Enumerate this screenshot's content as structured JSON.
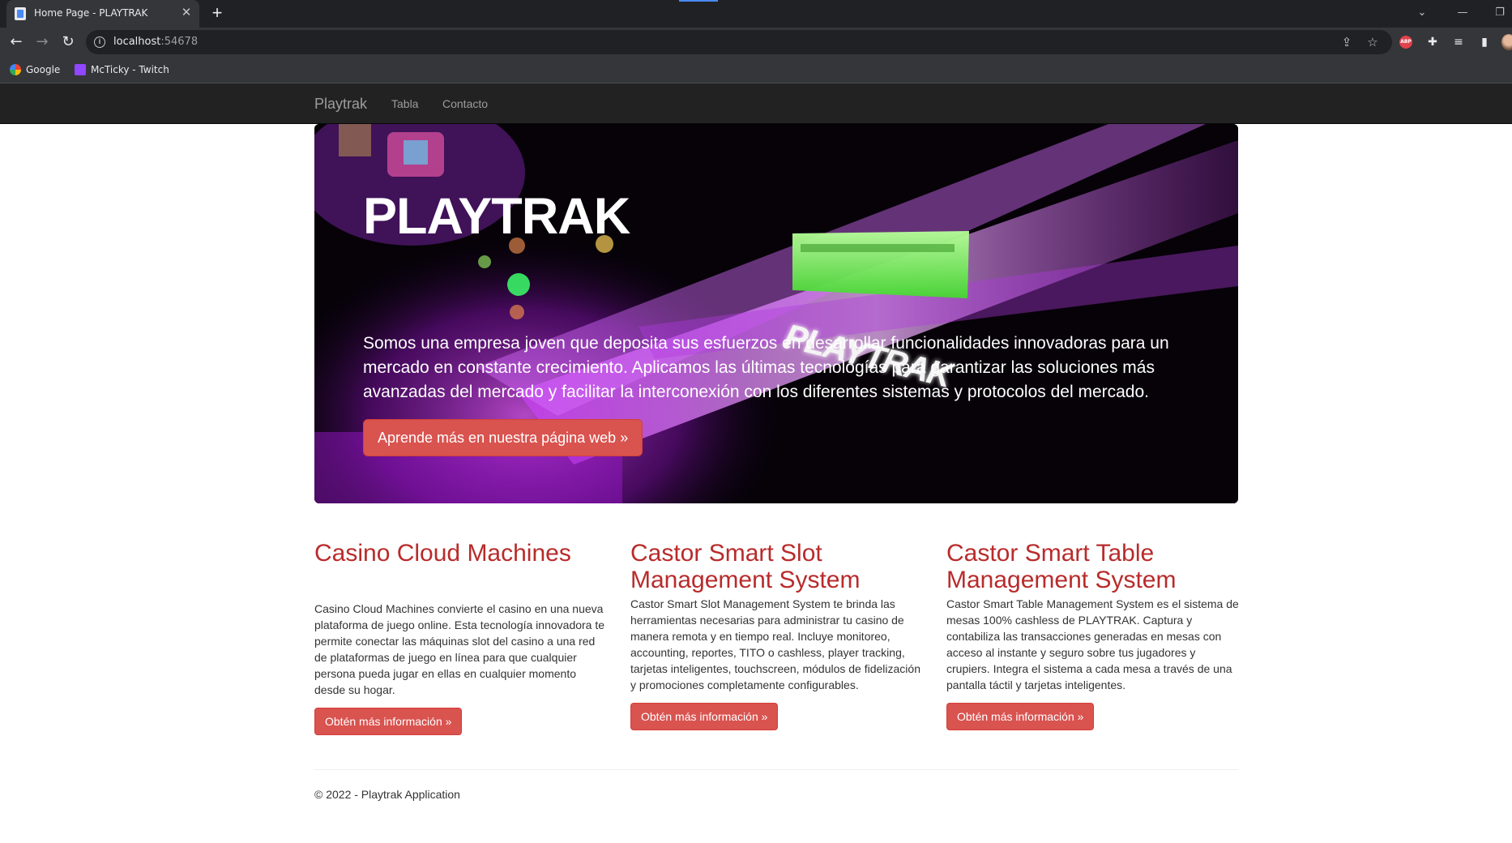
{
  "browser": {
    "tab_title": "Home Page - PLAYTRAK",
    "tab_close": "✕",
    "new_tab": "+",
    "url_host": "localhost",
    "url_port": ":54678",
    "bookmarks": [
      {
        "label": "Google",
        "icon": "google-icon"
      },
      {
        "label": "McTicky - Twitch",
        "icon": "twitch-icon"
      }
    ],
    "abp_label": "ABP"
  },
  "navbar": {
    "brand": "Playtrak",
    "links": [
      "Tabla",
      "Contacto"
    ]
  },
  "hero": {
    "title": "PLAYTRAK",
    "lead": "Somos una empresa joven que deposita sus esfuerzos en desarrollar funcionalidades innovadoras para un mercado en constante crecimiento. Aplicamos las últimas tecnologías para garantizar las soluciones más avanzadas del mercado y facilitar la interconexión con los diferentes sistemas y protocolos del mercado.",
    "button": "Aprende más en nuestra página web »",
    "image_text": "PLAYTRAK"
  },
  "columns": [
    {
      "title": "Casino Cloud Machines",
      "text": "Casino Cloud Machines convierte el casino en una nueva plataforma de juego online. Esta tecnología innovadora te permite conectar las máquinas slot del casino a una red de plataformas de juego en línea para que cualquier persona pueda jugar en ellas en cualquier momento desde su hogar.",
      "button": "Obtén más información »"
    },
    {
      "title": "Castor Smart Slot Management System",
      "text": "Castor Smart Slot Management System te brinda las herramientas necesarias para administrar tu casino de manera remota y en tiempo real. Incluye monitoreo, accounting, reportes, TITO o cashless, player tracking, tarjetas inteligentes, touchscreen, módulos de fidelización y promociones completamente configurables.",
      "button": "Obtén más información »"
    },
    {
      "title": "Castor Smart Table Management System",
      "text": "Castor Smart Table Management System es el sistema de mesas 100% cashless de PLAYTRAK. Captura y contabiliza las transacciones generadas en mesas con acceso al instante y seguro sobre tus jugadores y crupiers. Integra el sistema a cada mesa a través de una pantalla táctil y tarjetas inteligentes.",
      "button": "Obtén más información »"
    }
  ],
  "footer": {
    "text": "© 2022 - Playtrak Application"
  },
  "colors": {
    "navbar_bg": "#222222",
    "accent_red": "#d9534f",
    "heading_red": "#b92b2b",
    "hero_purple": "#b01ee0",
    "hero_green": "#7dff6a"
  }
}
